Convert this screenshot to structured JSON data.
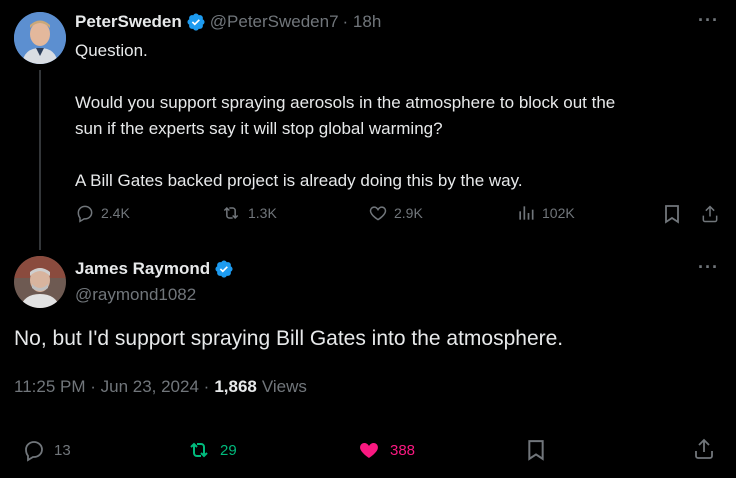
{
  "tweet": {
    "author_name": "PeterSweden",
    "author_handle": "@PeterSweden7",
    "time_ago": "· 18h",
    "more": "···",
    "text": "Question.\n\nWould you support spraying aerosols in the atmosphere to block out the\nsun if the experts say it will stop global warming?\n\nA Bill Gates backed project is already doing this by the way.",
    "actions": {
      "replies": "2.4K",
      "reposts": "1.3K",
      "likes": "2.9K",
      "views": "102K"
    }
  },
  "reply": {
    "author_name": "James Raymond",
    "author_handle": "@raymond1082",
    "more": "···",
    "text": "No, but I'd support spraying Bill Gates into the atmosphere.",
    "meta": {
      "time": "11:25 PM · Jun 23, 2024 ·",
      "views_count": "1,868",
      "views_label": "Views"
    },
    "actions": {
      "replies": "13",
      "reposts": "29",
      "likes": "388"
    }
  },
  "colors": {
    "background": "#000000",
    "text": "#e7e9ea",
    "muted": "#71767b",
    "verified": "#1d9bf0",
    "repost_active": "#00ba7c",
    "like_active": "#f91880"
  }
}
